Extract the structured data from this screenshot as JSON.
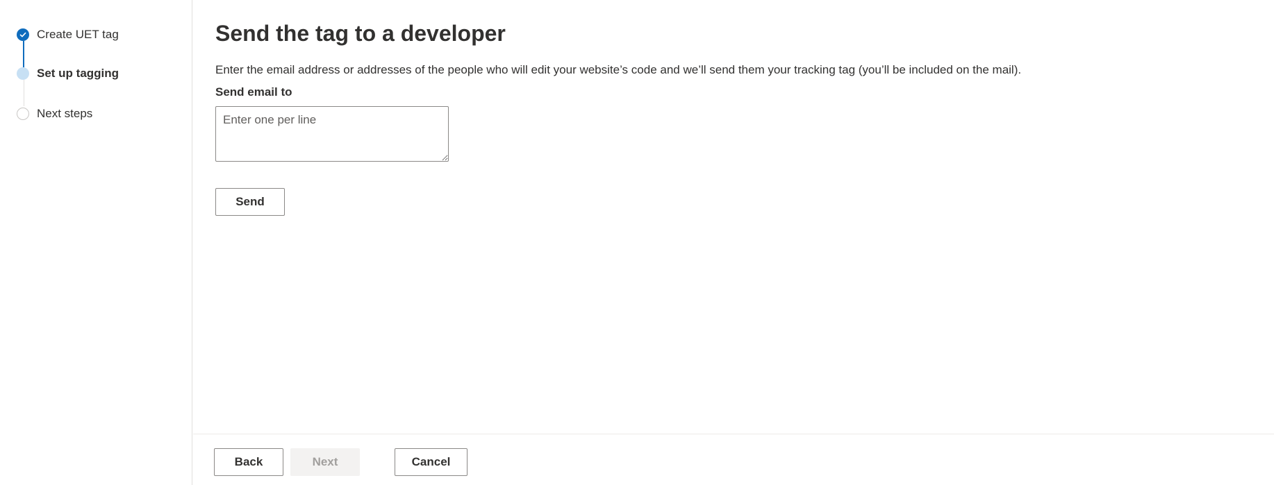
{
  "stepper": {
    "steps": [
      {
        "label": "Create UET tag",
        "state": "completed"
      },
      {
        "label": "Set up tagging",
        "state": "current"
      },
      {
        "label": "Next steps",
        "state": "upcoming"
      }
    ]
  },
  "main": {
    "title": "Send the tag to a developer",
    "description": "Enter the email address or addresses of the people who will edit your website’s code and we’ll send them your tracking tag (you’ll be included on the mail).",
    "email_field": {
      "label": "Send email to",
      "placeholder": "Enter one per line",
      "value": ""
    },
    "send_label": "Send"
  },
  "footer": {
    "back_label": "Back",
    "next_label": "Next",
    "cancel_label": "Cancel"
  },
  "colors": {
    "accent": "#0f6cbd",
    "current_step": "#c7e0f4",
    "disabled_bg": "#f3f2f1",
    "disabled_text": "#a19f9d"
  },
  "icons": {
    "completed_step": "checkmark-icon"
  }
}
